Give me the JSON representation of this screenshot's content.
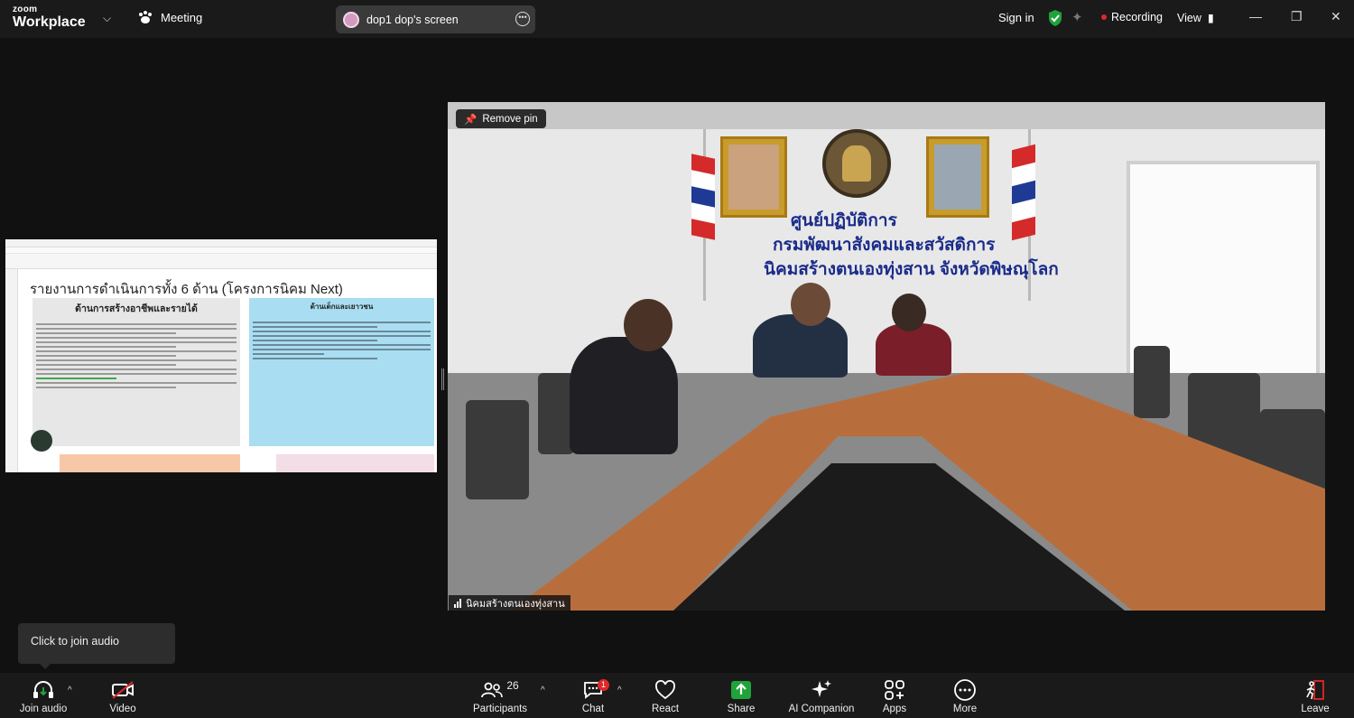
{
  "topbar": {
    "logo_line1": "zoom",
    "logo_line2": "Workplace",
    "meeting_label": "Meeting",
    "screen_share_label": "dop1 dop's screen",
    "sign_in": "Sign in",
    "recording": "Recording",
    "view": "View"
  },
  "shared_screen": {
    "heading": "รายงานการดำเนินการทั้ง 6 ด้าน (โครงการนิคม Next)",
    "panel_left_title": "ด้านการสร้างอาชีพและรายได้",
    "panel_right_title": "ด้านเด็กและเยาวชน"
  },
  "video": {
    "pin_label": "Remove pin",
    "participant_name": "นิคมสร้างตนเองทุ่งสาน",
    "sign_line1": "ศูนย์ปฏิบัติการ",
    "sign_line2": "กรมพัฒนาสังคมและสวัสดิการ",
    "sign_line3": "นิคมสร้างตนเองทุ่งสาน จังหวัดพิษณุโลก"
  },
  "tooltip": "Click to join audio",
  "toolbar": {
    "join_audio": "Join audio",
    "video": "Video",
    "participants": "Participants",
    "participant_count": "26",
    "chat": "Chat",
    "chat_badge": "1",
    "react": "React",
    "share": "Share",
    "ai_companion": "AI Companion",
    "apps": "Apps",
    "more": "More",
    "leave": "Leave"
  },
  "colors": {
    "share_green": "#1fa33a",
    "shield_green": "#1fa33a",
    "recording_red": "#e02828",
    "leave_red": "#e02828"
  }
}
